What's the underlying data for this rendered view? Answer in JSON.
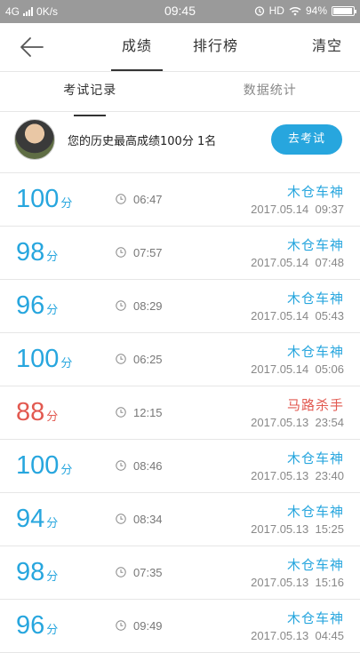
{
  "status_bar": {
    "network": "4G",
    "speed": "0K/s",
    "time": "09:45",
    "hd": "HD",
    "battery": "94%",
    "battery_level": 0.94
  },
  "header": {
    "tabs": [
      {
        "label": "成绩",
        "active": true
      },
      {
        "label": "排行榜",
        "active": false
      }
    ],
    "clear_label": "清空"
  },
  "sub_tabs": [
    {
      "label": "考试记录",
      "active": true
    },
    {
      "label": "数据统计",
      "active": false
    }
  ],
  "profile": {
    "best_text": "您的历史最高成绩100分  1名",
    "exam_button": "去考试"
  },
  "colors": {
    "accent": "#27a6de",
    "warning": "#e25950"
  },
  "records": [
    {
      "score": "100",
      "unit": "分",
      "duration": "06:47",
      "title": "木仓车神",
      "date": "2017.05.14  09:37",
      "low": false
    },
    {
      "score": "98",
      "unit": "分",
      "duration": "07:57",
      "title": "木仓车神",
      "date": "2017.05.14  07:48",
      "low": false
    },
    {
      "score": "96",
      "unit": "分",
      "duration": "08:29",
      "title": "木仓车神",
      "date": "2017.05.14  05:43",
      "low": false
    },
    {
      "score": "100",
      "unit": "分",
      "duration": "06:25",
      "title": "木仓车神",
      "date": "2017.05.14  05:06",
      "low": false
    },
    {
      "score": "88",
      "unit": "分",
      "duration": "12:15",
      "title": "马路杀手",
      "date": "2017.05.13  23:54",
      "low": true
    },
    {
      "score": "100",
      "unit": "分",
      "duration": "08:46",
      "title": "木仓车神",
      "date": "2017.05.13  23:40",
      "low": false
    },
    {
      "score": "94",
      "unit": "分",
      "duration": "08:34",
      "title": "木仓车神",
      "date": "2017.05.13  15:25",
      "low": false
    },
    {
      "score": "98",
      "unit": "分",
      "duration": "07:35",
      "title": "木仓车神",
      "date": "2017.05.13  15:16",
      "low": false
    },
    {
      "score": "96",
      "unit": "分",
      "duration": "09:49",
      "title": "木仓车神",
      "date": "2017.05.13  04:45",
      "low": false
    }
  ]
}
